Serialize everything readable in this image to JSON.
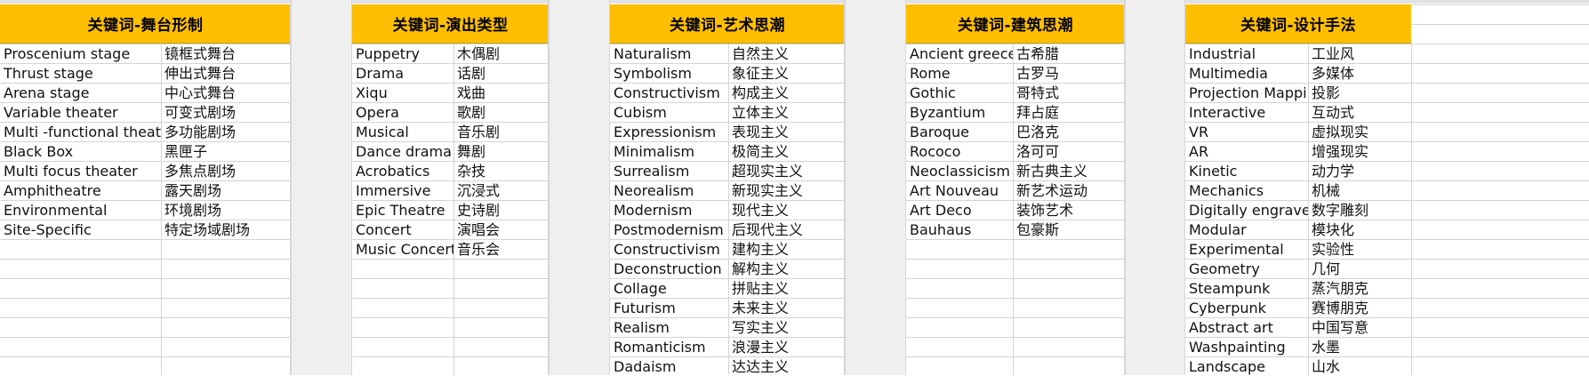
{
  "tables": [
    {
      "header": "关键词-舞台形制",
      "rows": [
        [
          "Proscenium stage",
          "镜框式舞台"
        ],
        [
          "Thrust stage",
          "伸出式舞台"
        ],
        [
          "Arena stage",
          "中心式舞台"
        ],
        [
          "Variable theater",
          "可变式剧场"
        ],
        [
          "Multi -functional theater",
          "多功能剧场"
        ],
        [
          "Black Box",
          "黑匣子"
        ],
        [
          "Multi focus theater",
          "多焦点剧场"
        ],
        [
          "Amphitheatre",
          "露天剧场"
        ],
        [
          "Environmental",
          "环境剧场"
        ],
        [
          "Site-Specific",
          "特定场域剧场"
        ]
      ]
    },
    {
      "header": "关键词-演出类型",
      "rows": [
        [
          "Puppetry",
          "木偶剧"
        ],
        [
          "Drama",
          "话剧"
        ],
        [
          "Xiqu",
          "戏曲"
        ],
        [
          "Opera",
          "歌剧"
        ],
        [
          "Musical",
          "音乐剧"
        ],
        [
          "Dance drama",
          "舞剧"
        ],
        [
          "Acrobatics",
          "杂技"
        ],
        [
          "Immersive",
          "沉浸式"
        ],
        [
          "Epic Theatre",
          "史诗剧"
        ],
        [
          "Concert",
          "演唱会"
        ],
        [
          "Music Concert",
          "音乐会"
        ]
      ]
    },
    {
      "header": "关键词-艺术思潮",
      "rows": [
        [
          "Naturalism",
          "自然主义"
        ],
        [
          "Symbolism",
          "象征主义"
        ],
        [
          "Constructivism",
          "构成主义"
        ],
        [
          "Cubism",
          "立体主义"
        ],
        [
          "Expressionism",
          "表现主义"
        ],
        [
          "Minimalism",
          "极简主义"
        ],
        [
          "Surrealism",
          "超现实主义"
        ],
        [
          "Neorealism",
          "新现实主义"
        ],
        [
          "Modernism",
          "现代主义"
        ],
        [
          "Postmodernism",
          "后现代主义"
        ],
        [
          "Constructivism",
          "建构主义"
        ],
        [
          "Deconstruction",
          "解构主义"
        ],
        [
          "Collage",
          "拼贴主义"
        ],
        [
          "Futurism",
          "未来主义"
        ],
        [
          "Realism",
          "写实主义"
        ],
        [
          "Romanticism",
          "浪漫主义"
        ],
        [
          "Dadaism",
          "达达主义"
        ]
      ]
    },
    {
      "header": "关键词-建筑思潮",
      "rows": [
        [
          "Ancient greece",
          "古希腊"
        ],
        [
          "Rome",
          "古罗马"
        ],
        [
          "Gothic",
          "哥特式"
        ],
        [
          "Byzantium",
          "拜占庭"
        ],
        [
          "Baroque",
          "巴洛克"
        ],
        [
          "Rococo",
          "洛可可"
        ],
        [
          "Neoclassicism",
          "新古典主义"
        ],
        [
          "Art Nouveau",
          "新艺术运动"
        ],
        [
          "Art Deco",
          "装饰艺术"
        ],
        [
          "Bauhaus",
          "包豪斯"
        ]
      ]
    },
    {
      "header": "关键词-设计手法",
      "rows": [
        [
          "Industrial",
          "工业风"
        ],
        [
          "Multimedia",
          "多媒体"
        ],
        [
          "Projection Mapping",
          "投影"
        ],
        [
          "Interactive",
          "互动式"
        ],
        [
          "VR",
          "虚拟现实"
        ],
        [
          "AR",
          "增强现实"
        ],
        [
          "Kinetic",
          "动力学"
        ],
        [
          "Mechanics",
          "机械"
        ],
        [
          "Digitally engraved",
          "数字雕刻"
        ],
        [
          "Modular",
          "模块化"
        ],
        [
          "Experimental",
          "实验性"
        ],
        [
          "Geometry",
          "几何"
        ],
        [
          "Steampunk",
          "蒸汽朋克"
        ],
        [
          "Cyberpunk",
          "赛博朋克"
        ],
        [
          "Abstract art",
          "中国写意"
        ],
        [
          "Washpainting",
          "水墨"
        ],
        [
          "Landscape",
          "山水"
        ]
      ]
    }
  ]
}
